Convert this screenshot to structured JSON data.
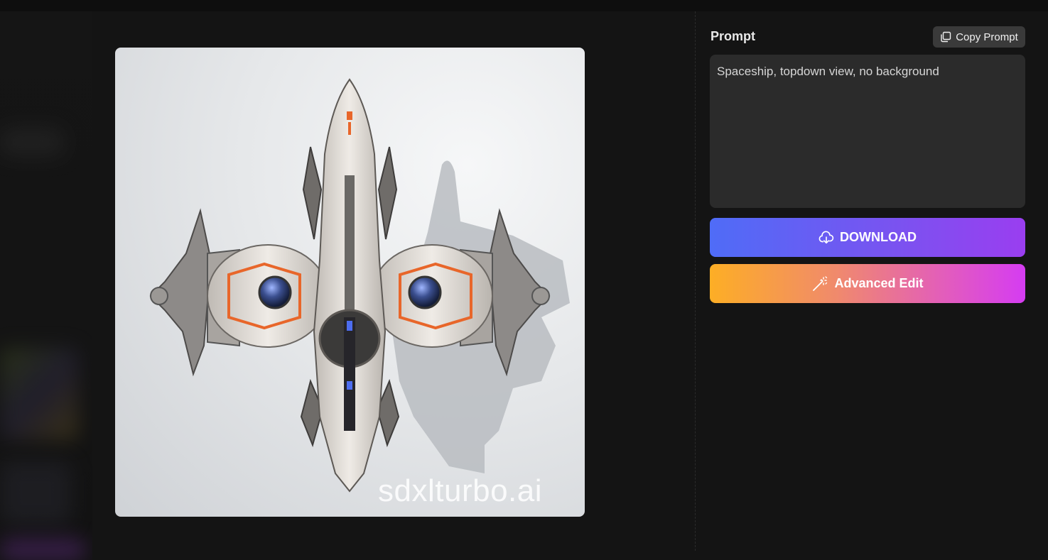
{
  "prompt_panel": {
    "label": "Prompt",
    "copy_button_label": "Copy Prompt",
    "prompt_text": "Spaceship, topdown view, no background"
  },
  "actions": {
    "download_label": "DOWNLOAD",
    "advanced_edit_label": "Advanced Edit"
  },
  "image": {
    "watermark": "sdxlturbo.ai"
  },
  "icons": {
    "copy": "copy-icon",
    "download": "cloud-download-icon",
    "edit": "magic-wand-icon"
  },
  "colors": {
    "download_gradient": [
      "#4f6cf7",
      "#9a3ef0"
    ],
    "edit_gradient": [
      "#fdae25",
      "#d53cf2"
    ],
    "accent_orange": "#e8662a"
  }
}
